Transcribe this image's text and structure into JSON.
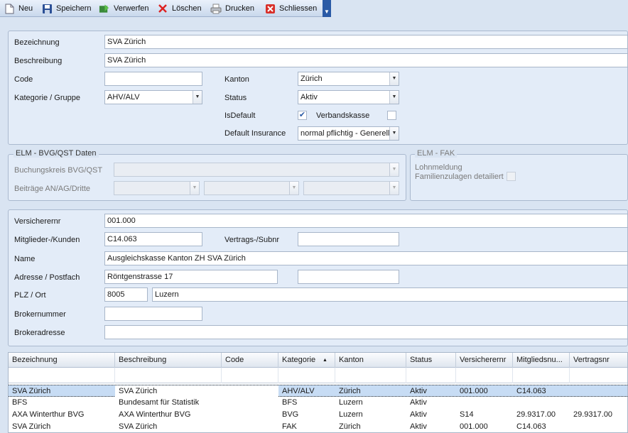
{
  "toolbar": {
    "neu": "Neu",
    "speichern": "Speichern",
    "verwerfen": "Verwerfen",
    "loeschen": "Löschen",
    "drucken": "Drucken",
    "schliessen": "Schliessen"
  },
  "general": {
    "bezeichnung_label": "Bezeichnung",
    "bezeichnung_value": "SVA Zürich",
    "beschreibung_label": "Beschreibung",
    "beschreibung_value": "SVA Zürich",
    "code_label": "Code",
    "code_value": "",
    "kategorie_label": "Kategorie / Gruppe",
    "kategorie_value": "AHV/ALV",
    "kanton_label": "Kanton",
    "kanton_value": "Zürich",
    "status_label": "Status",
    "status_value": "Aktiv",
    "isdefault_label": "IsDefault",
    "isdefault_checked": "✔",
    "verbandskasse_label": "Verbandskasse",
    "default_insurance_label": "Default Insurance",
    "default_insurance_value": "normal pflichtig - Generell a"
  },
  "elm_bvg": {
    "title": "ELM - BVG/QST Daten",
    "buchungskreis_label": "Buchungskreis BVG/QST",
    "beitraege_label": "Beiträge AN/AG/Dritte"
  },
  "elm_fak": {
    "title": "ELM - FAK",
    "lohnmeldung_label": "Lohnmeldung",
    "familienzulagen_label": "Familienzulagen detailiert"
  },
  "insurer": {
    "versicherernr_label": "Versicherernr",
    "versicherernr_value": "001.000",
    "mitglieder_label": "Mitglieder-/Kunden",
    "mitglieder_value": "C14.063",
    "vertrags_label": "Vertrags-/Subnr",
    "vertrags_value": "",
    "name_label": "Name",
    "name_value": "Ausgleichskasse Kanton ZH SVA Zürich",
    "adresse_label": "Adresse / Postfach",
    "adresse_value": "Röntgenstrasse 17",
    "postfach_value": "",
    "plz_label": "PLZ / Ort",
    "plz_value": "8005",
    "ort_value": "Luzern",
    "brokernummer_label": "Brokernummer",
    "brokernummer_value": "",
    "brokeradresse_label": "Brokeradresse",
    "brokeradresse_value": ""
  },
  "grid": {
    "columns": [
      "Bezeichnung",
      "Beschreibung",
      "Code",
      "Kategorie",
      "Kanton",
      "Status",
      "Versicherernr",
      "Mitgliedsnu...",
      "Vertragsnr"
    ],
    "sort_indicator": "▲",
    "rows": [
      [
        "SVA Zürich",
        "SVA Zürich",
        "",
        "AHV/ALV",
        "Zürich",
        "Aktiv",
        "001.000",
        "C14.063",
        ""
      ],
      [
        "BFS",
        "Bundesamt für Statistik",
        "",
        "BFS",
        "Luzern",
        "Aktiv",
        "",
        "",
        ""
      ],
      [
        "AXA Winterthur BVG",
        "AXA Winterthur BVG",
        "",
        "BVG",
        "Luzern",
        "Aktiv",
        "S14",
        "29.9317.00",
        "29.9317.00"
      ],
      [
        "SVA Zürich",
        "SVA Zürich",
        "",
        "FAK",
        "Zürich",
        "Aktiv",
        "001.000",
        "C14.063",
        ""
      ]
    ]
  },
  "colors": {
    "accent": "#2a5aa6",
    "selected_row": "#c7dcf4",
    "panel": "#e3ecf8"
  }
}
